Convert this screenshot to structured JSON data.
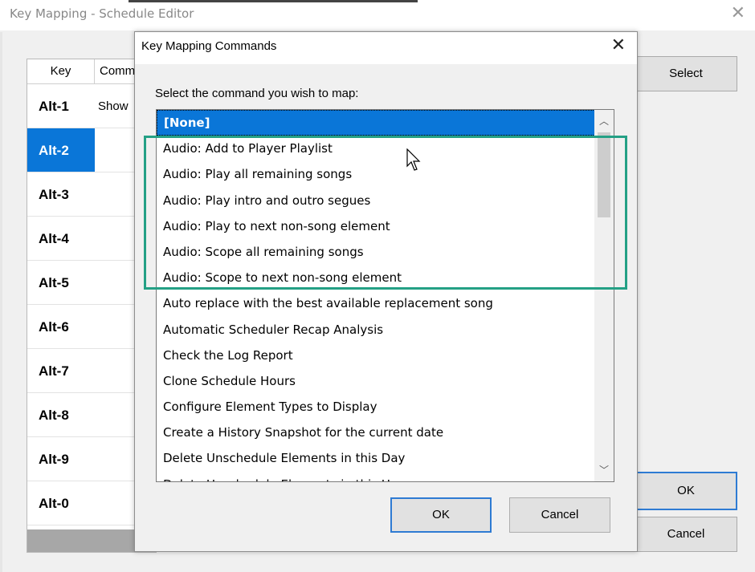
{
  "background_window": {
    "title": "Key Mapping - Schedule Editor",
    "close_glyph": "✕",
    "grid": {
      "col_key": "Key",
      "col_command": "Comm",
      "rows": [
        {
          "key": "Alt-1",
          "command": "Show",
          "selected": false
        },
        {
          "key": "Alt-2",
          "command": "",
          "selected": true
        },
        {
          "key": "Alt-3",
          "command": "",
          "selected": false
        },
        {
          "key": "Alt-4",
          "command": "",
          "selected": false
        },
        {
          "key": "Alt-5",
          "command": "",
          "selected": false
        },
        {
          "key": "Alt-6",
          "command": "",
          "selected": false
        },
        {
          "key": "Alt-7",
          "command": "",
          "selected": false
        },
        {
          "key": "Alt-8",
          "command": "",
          "selected": false
        },
        {
          "key": "Alt-9",
          "command": "",
          "selected": false
        },
        {
          "key": "Alt-0",
          "command": "",
          "selected": false
        }
      ]
    },
    "buttons": {
      "select": "Select",
      "ok": "OK",
      "cancel": "Cancel"
    }
  },
  "dialog": {
    "title": "Key Mapping Commands",
    "close_glyph": "✕",
    "prompt": "Select the command you wish to map:",
    "commands": [
      "[None]",
      "Audio: Add to Player Playlist",
      "Audio: Play all remaining songs",
      "Audio: Play intro and outro segues",
      "Audio: Play to next non-song element",
      "Audio: Scope all remaining songs",
      "Audio: Scope to next non-song element",
      "Auto replace with the best available replacement song",
      "Automatic Scheduler Recap Analysis",
      "Check the Log Report",
      "Clone Schedule Hours",
      "Configure Element Types to Display",
      "Create a History Snapshot for the current date",
      "Delete Unschedule Elements in this Day",
      "Delete Unschedule Elements in this Hour"
    ],
    "selected_index": 0,
    "scroll_up_glyph": "︿",
    "scroll_down_glyph": "﹀",
    "buttons": {
      "ok": "OK",
      "cancel": "Cancel"
    }
  },
  "annotation": {
    "highlight_color": "#24a085",
    "accent_color": "#0a76d8"
  }
}
